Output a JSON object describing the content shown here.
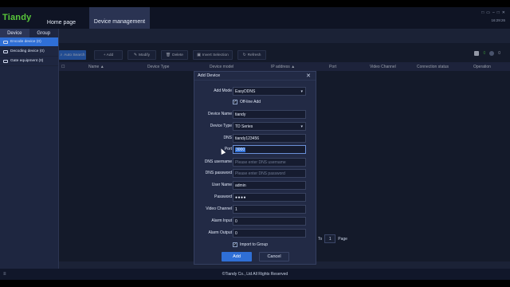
{
  "app": {
    "logo": "Tiandy",
    "nav": {
      "home": "Home page",
      "device_management": "Device management"
    },
    "window_controls": [
      "□",
      "▭",
      "–",
      "□",
      "✕"
    ],
    "time": "16:29:26"
  },
  "sidebar": {
    "tabs": [
      "Device",
      "Group"
    ],
    "items": [
      {
        "label": "Encode device (0)",
        "active": true
      },
      {
        "label": "Decoding device (0)",
        "active": false
      },
      {
        "label": "Gate equipment (0)",
        "active": false
      }
    ]
  },
  "toolbar": {
    "auto_search": "Auto Search",
    "add": "+ Add",
    "modify": "Modify",
    "delete": "Delete",
    "invert_selection": "Invert Selection",
    "refresh": "Refresh",
    "online_count": "0",
    "offline_count": "0"
  },
  "table": {
    "headers": [
      "Name ▲",
      "Device Type",
      "Device model",
      "IP address ▲",
      "Port",
      "Video Channel",
      "Connection status",
      "Operation"
    ]
  },
  "pager": {
    "to": "To",
    "page": "1",
    "page_label": "Page"
  },
  "footer": {
    "copyright": "©Tiandy Co., Ltd All Rights Reserved",
    "left_icon": "≡"
  },
  "dialog": {
    "title": "Add Device",
    "close": "✕",
    "fields": {
      "add_mode": {
        "label": "Add Mode",
        "value": "EasyDDNS"
      },
      "offline_add": {
        "label": "Off-line Add",
        "checked": true
      },
      "device_name": {
        "label": "Device Name",
        "value": "tiandy"
      },
      "device_type": {
        "label": "Device Type",
        "value": "TD Series"
      },
      "dns": {
        "label": "DNS",
        "value": "tiandy123456"
      },
      "port": {
        "label": "Port",
        "value": "3000"
      },
      "dns_username": {
        "label": "DNS username",
        "placeholder": "Please enter DNS username"
      },
      "dns_password": {
        "label": "DNS password",
        "placeholder": "Please enter DNS password"
      },
      "user_name": {
        "label": "User Name",
        "value": "admin"
      },
      "password": {
        "label": "Password",
        "value": "●●●●"
      },
      "video_channel": {
        "label": "Video Channel",
        "value": "1"
      },
      "alarm_input": {
        "label": "Alarm Input",
        "value": "0"
      },
      "alarm_output": {
        "label": "Alarm Output",
        "value": "0"
      },
      "import_to_group": {
        "label": "Import to Group",
        "checked": true
      }
    },
    "buttons": {
      "add": "Add",
      "cancel": "Cancel"
    },
    "checkmark": "✓"
  }
}
